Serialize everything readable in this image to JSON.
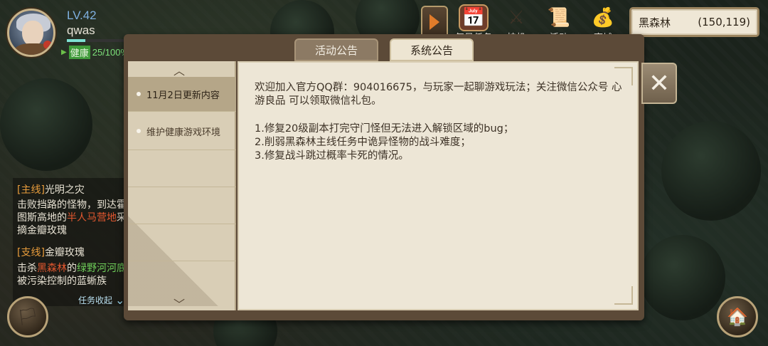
{
  "player": {
    "level": "LV.42",
    "name": "qwas",
    "health_label": "健康",
    "health_value": "25/100%",
    "hp_fraction": 0.25
  },
  "top_menu": {
    "items": [
      {
        "label": "每日任务",
        "icon": "calendar-book-icon"
      },
      {
        "label": "挂机",
        "icon": "crossed-swords-icon"
      },
      {
        "label": "活动",
        "icon": "scroll-map-icon"
      },
      {
        "label": "商城",
        "icon": "gold-coins-icon"
      }
    ],
    "expand_icon": "play-arrow-icon"
  },
  "location": {
    "name": "黑森林",
    "coords": "(150,119)"
  },
  "quests": {
    "main_bracket": "[主线]",
    "main_title": "光明之灾",
    "main_desc_1": "击败挡路的怪物，到达霍图斯高地的",
    "main_desc_hl": "半人马营地",
    "main_desc_2": "采摘金瓣玫瑰",
    "side_bracket": "[支线]",
    "side_title": "金瓣玫瑰",
    "side_desc_1": "击杀",
    "side_desc_hl1": "黑森林",
    "side_desc_2": "的",
    "side_desc_green": "绿野河河底",
    "side_desc_3": "被污染控制的蓝蜥族",
    "collapse_label": "任务收起"
  },
  "dialog": {
    "tabs": [
      {
        "label": "活动公告",
        "active": false
      },
      {
        "label": "系统公告",
        "active": true
      }
    ],
    "side_items": [
      {
        "label": "11月2日更新内容",
        "selected": true
      },
      {
        "label": "维护健康游戏环境",
        "selected": false
      }
    ],
    "content": {
      "intro": "欢迎加入官方QQ群：904016675，与玩家一起聊游戏玩法；关注微信公众号 心游良品 可以领取微信礼包。",
      "line1": "1.修复20级副本打完守门怪但无法进入解锁区域的bug；",
      "line2": "2.削弱黑森林主线任务中诡异怪物的战斗难度；",
      "line3": "3.修复战斗跳过概率卡死的情况。"
    },
    "close_icon": "close-x-icon"
  }
}
